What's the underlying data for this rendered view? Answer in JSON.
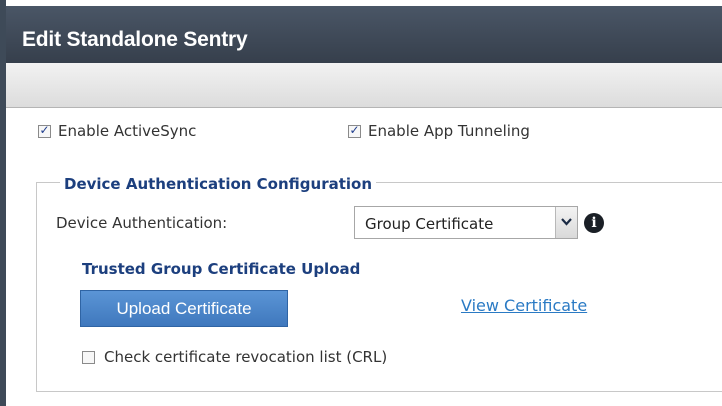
{
  "dialog": {
    "title": "Edit Standalone Sentry"
  },
  "options": {
    "enable_activesync": {
      "label": "Enable ActiveSync",
      "checked": true
    },
    "enable_app_tunneling": {
      "label": "Enable App Tunneling",
      "checked": true
    }
  },
  "device_auth_config": {
    "legend": "Device Authentication Configuration",
    "device_authentication_label": "Device Authentication:",
    "device_authentication_value": "Group Certificate",
    "info_icon": "info-icon",
    "trusted_upload_heading": "Trusted Group Certificate Upload",
    "upload_button_label": "Upload Certificate",
    "view_link_label": "View Certificate",
    "crl_checkbox": {
      "label": "Check certificate revocation list (CRL)",
      "checked": false
    }
  },
  "colors": {
    "titlebar": "#3e4a58",
    "heading_blue": "#1c3f7e",
    "button_blue": "#4a85c9",
    "link_blue": "#2a7ac4"
  }
}
